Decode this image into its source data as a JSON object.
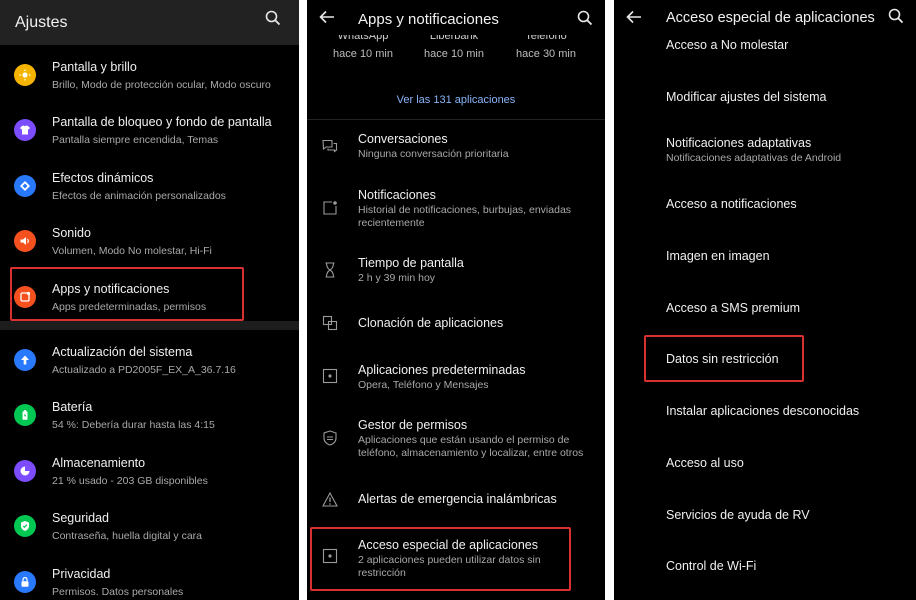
{
  "panel1": {
    "title": "Ajustes",
    "items": [
      {
        "title": "Pantalla y brillo",
        "subtitle": "Brillo, Modo de protección ocular, Modo oscuro",
        "color": "#f4b400",
        "icon": "sun-icon"
      },
      {
        "title": "Pantalla de bloqueo y fondo de pantalla",
        "subtitle": "Pantalla siempre encendida, Temas",
        "color": "#7c4dff",
        "icon": "shirt-icon"
      },
      {
        "title": "Efectos dinámicos",
        "subtitle": "Efectos de animación personalizados",
        "color": "#2979ff",
        "icon": "diamond-icon"
      },
      {
        "title": "Sonido",
        "subtitle": "Volumen, Modo No molestar, Hi-Fi",
        "color": "#f4511e",
        "icon": "speaker-icon"
      },
      {
        "title": "Apps y notificaciones",
        "subtitle": "Apps predeterminadas, permisos",
        "color": "#f4511e",
        "icon": "apps-icon"
      },
      {
        "title": "Actualización del sistema",
        "subtitle": "Actualizado a PD2005F_EX_A_36.7.16",
        "color": "#2979ff",
        "icon": "arrow-up-icon"
      },
      {
        "title": "Batería",
        "subtitle": "54 %: Debería durar hasta las 4:15",
        "color": "#00c853",
        "icon": "battery-icon"
      },
      {
        "title": "Almacenamiento",
        "subtitle": "21 % usado - 203 GB disponibles",
        "color": "#7c4dff",
        "icon": "pie-icon"
      },
      {
        "title": "Seguridad",
        "subtitle": "Contraseña, huella digital y cara",
        "color": "#00c853",
        "icon": "shield-icon"
      },
      {
        "title": "Privacidad",
        "subtitle": "Permisos. Datos personales",
        "color": "#2979ff",
        "icon": "lock-icon"
      }
    ]
  },
  "panel2": {
    "title": "Apps y notificaciones",
    "recent_apps": [
      {
        "name": "WhatsApp",
        "time": "hace 10 min"
      },
      {
        "name": "Liberbank",
        "time": "hace 10 min"
      },
      {
        "name": "Teléfono",
        "time": "hace 30 min"
      }
    ],
    "see_all": "Ver las 131 aplicaciones",
    "items": [
      {
        "title": "Conversaciones",
        "subtitle": "Ninguna conversación prioritaria",
        "icon": "chat-icon"
      },
      {
        "title": "Notificaciones",
        "subtitle": "Historial de notificaciones, burbujas, enviadas recientemente",
        "icon": "notification-icon"
      },
      {
        "title": "Tiempo de pantalla",
        "subtitle": "2 h y 39 min hoy",
        "icon": "hourglass-icon"
      },
      {
        "title": "Clonación de aplicaciones",
        "subtitle": "",
        "icon": "clone-icon"
      },
      {
        "title": "Aplicaciones predeterminadas",
        "subtitle": "Opera, Teléfono y Mensajes",
        "icon": "default-app-icon"
      },
      {
        "title": "Gestor de permisos",
        "subtitle": "Aplicaciones que están usando el permiso de teléfono, almacenamiento y localizar, entre otros",
        "icon": "permission-shield-icon"
      },
      {
        "title": "Alertas de emergencia inalámbricas",
        "subtitle": "",
        "icon": "warning-icon"
      },
      {
        "title": "Acceso especial de aplicaciones",
        "subtitle": "2 aplicaciones pueden utilizar datos sin restricción",
        "icon": "special-access-icon"
      }
    ]
  },
  "panel3": {
    "title": "Acceso especial de aplicaciones",
    "items": [
      {
        "title": "Acceso a No molestar",
        "subtitle": ""
      },
      {
        "title": "Modificar ajustes del sistema",
        "subtitle": ""
      },
      {
        "title": "Notificaciones adaptativas",
        "subtitle": "Notificaciones adaptativas de Android"
      },
      {
        "title": "Acceso a notificaciones",
        "subtitle": ""
      },
      {
        "title": "Imagen en imagen",
        "subtitle": ""
      },
      {
        "title": "Acceso a SMS premium",
        "subtitle": ""
      },
      {
        "title": "Datos sin restricción",
        "subtitle": ""
      },
      {
        "title": "Instalar aplicaciones desconocidas",
        "subtitle": ""
      },
      {
        "title": "Acceso al uso",
        "subtitle": ""
      },
      {
        "title": "Servicios de ayuda de RV",
        "subtitle": ""
      },
      {
        "title": "Control de Wi-Fi",
        "subtitle": ""
      }
    ]
  },
  "colors": {
    "highlight": "#d93030",
    "link": "#8ab4f8"
  }
}
